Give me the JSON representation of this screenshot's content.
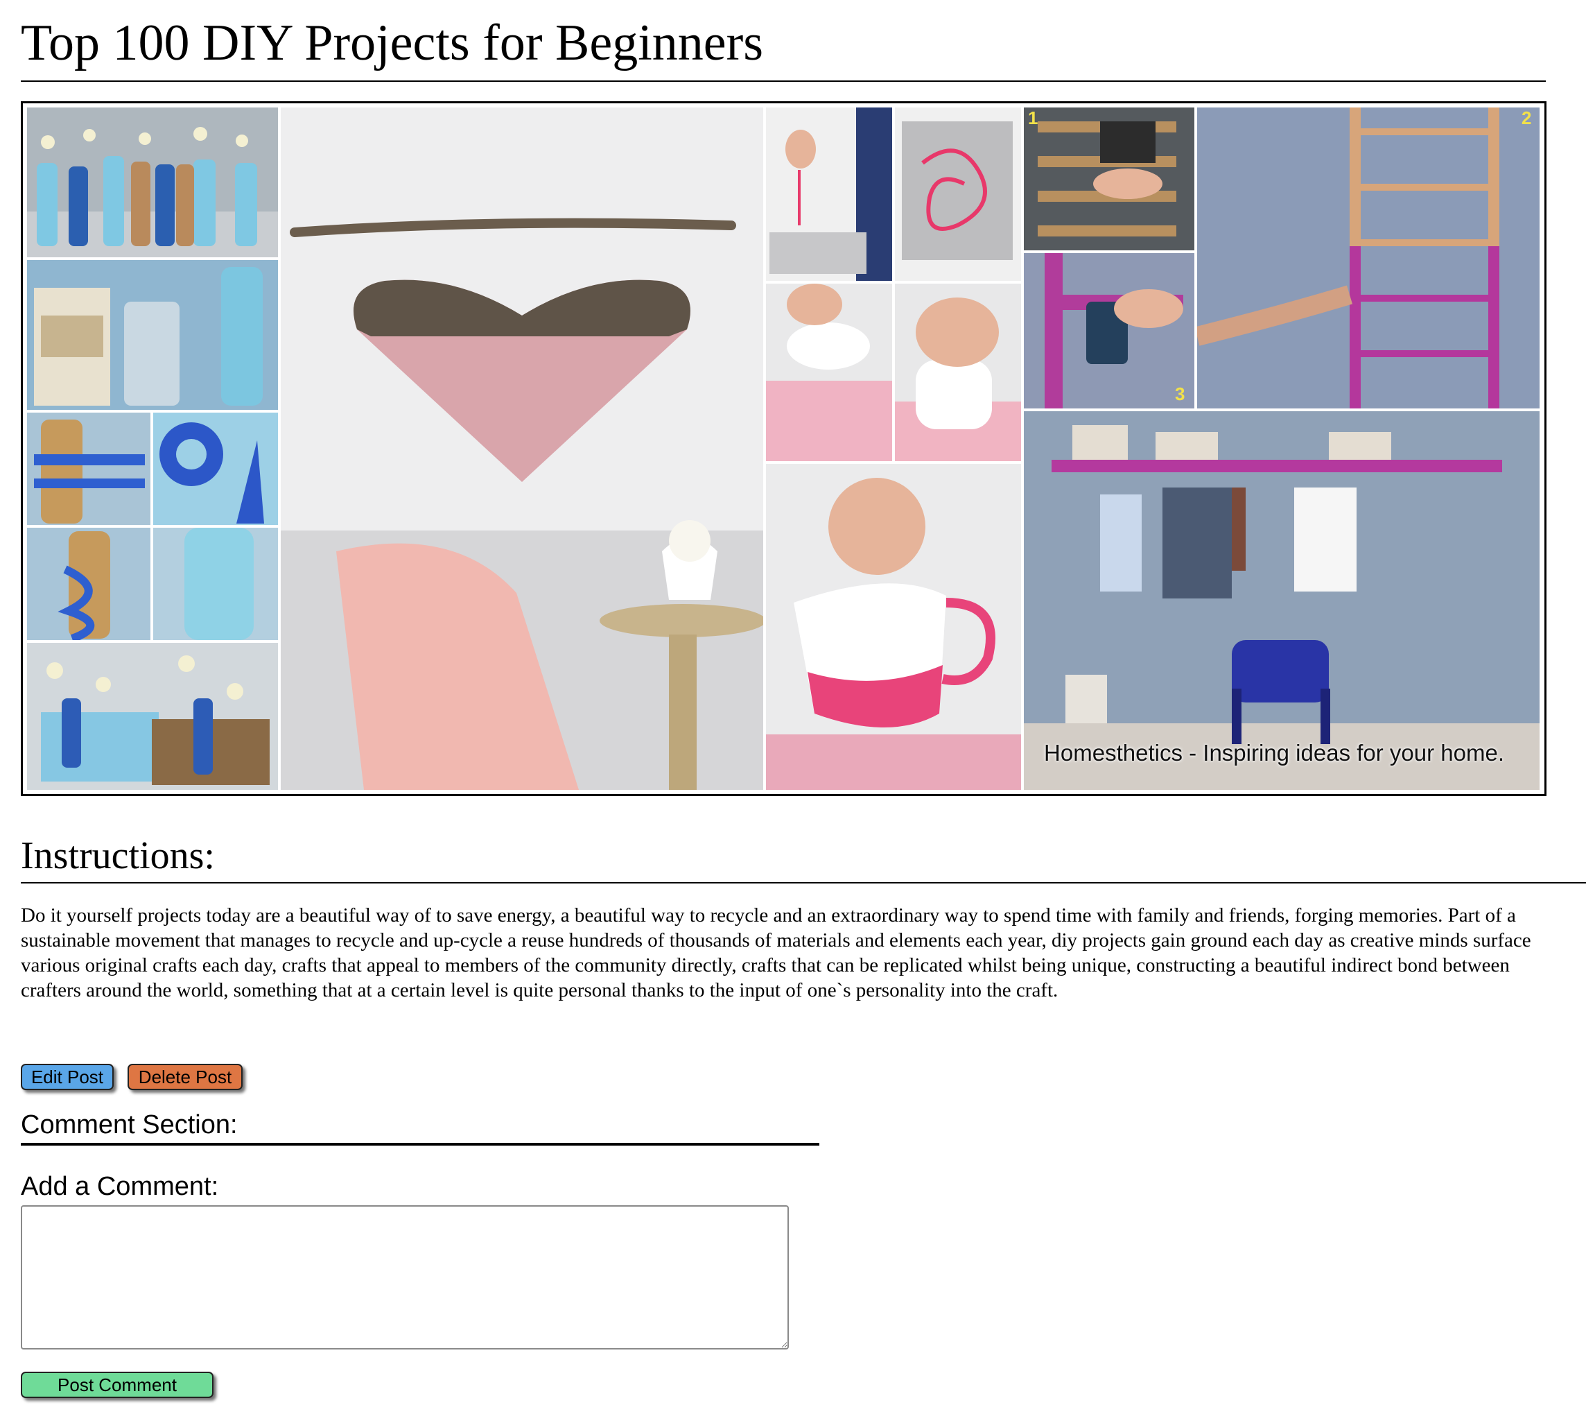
{
  "post": {
    "title": "Top 100 DIY Projects for Beginners",
    "image": {
      "watermark": "Homesthetics - Inspiring ideas for your home.",
      "step_numbers": [
        "1",
        "2",
        "3"
      ]
    },
    "instructions_heading": "Instructions:",
    "instructions_text": "Do it yourself projects today are a beautiful way of to save energy, a beautiful way to recycle and an extraordinary way to spend time with family and friends, forging memories. Part of a sustainable movement that manages to recycle and up-cycle a reuse hundreds of thousands of materials and elements each year, diy projects gain ground each day as creative minds surface various original crafts each day, crafts that appeal to members of the community directly, crafts that can be replicated whilst being unique, constructing a beautiful indirect bond between crafters around the world, something that at a certain level is quite personal thanks to the input of one`s personality into the craft."
  },
  "actions": {
    "edit_label": "Edit Post",
    "delete_label": "Delete Post"
  },
  "comments": {
    "section_title": "Comment Section:",
    "add_label": "Add a Comment:",
    "input_value": "",
    "submit_label": "Post Comment"
  },
  "colors": {
    "edit_button": "#5aa6e8",
    "delete_button": "#de7643",
    "post_button": "#6fdb98"
  }
}
